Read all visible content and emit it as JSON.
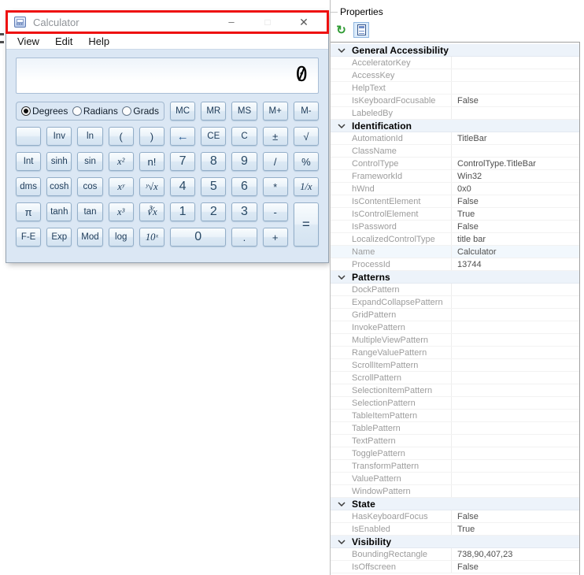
{
  "calc": {
    "title": "Calculator",
    "window_icons": {
      "minimize": "–",
      "maximize": "□",
      "close": "✕"
    },
    "menu": [
      {
        "label": "View",
        "id": "view"
      },
      {
        "label": "Edit",
        "id": "edit"
      },
      {
        "label": "Help",
        "id": "help"
      }
    ],
    "display_value": "0",
    "angle_modes": [
      {
        "label": "Degrees",
        "id": "degrees",
        "selected": true
      },
      {
        "label": "Radians",
        "id": "radians",
        "selected": false
      },
      {
        "label": "Grads",
        "id": "grads",
        "selected": false
      }
    ],
    "memory_keys": [
      {
        "label": "MC",
        "id": "memory-clear"
      },
      {
        "label": "MR",
        "id": "memory-recall"
      },
      {
        "label": "MS",
        "id": "memory-store"
      },
      {
        "label": "M+",
        "id": "memory-add"
      },
      {
        "label": "M-",
        "id": "memory-subtract"
      }
    ],
    "keys": [
      {
        "label": "",
        "id": "blank",
        "cls": "blank"
      },
      {
        "label": "Inv",
        "id": "inverse"
      },
      {
        "label": "ln",
        "id": "natural-log"
      },
      {
        "label": "(",
        "id": "open-paren",
        "cls": "op"
      },
      {
        "label": ")",
        "id": "close-paren",
        "cls": "op"
      },
      {
        "label": "←",
        "id": "backspace",
        "cls": "backspace"
      },
      {
        "label": "CE",
        "id": "clear-entry"
      },
      {
        "label": "C",
        "id": "clear"
      },
      {
        "label": "±",
        "id": "negate",
        "cls": "op"
      },
      {
        "label": "√",
        "id": "sqrt",
        "cls": "op"
      },
      {
        "label": "Int",
        "id": "int"
      },
      {
        "label": "sinh",
        "id": "sinh"
      },
      {
        "label": "sin",
        "id": "sin"
      },
      {
        "label": "x²",
        "id": "x-squared",
        "cls": "it"
      },
      {
        "label": "n!",
        "id": "factorial",
        "cls": "op"
      },
      {
        "label": "7",
        "id": "7",
        "cls": "num"
      },
      {
        "label": "8",
        "id": "8",
        "cls": "num"
      },
      {
        "label": "9",
        "id": "9",
        "cls": "num"
      },
      {
        "label": "/",
        "id": "divide",
        "cls": "op"
      },
      {
        "label": "%",
        "id": "percent",
        "cls": "op"
      },
      {
        "label": "dms",
        "id": "dms"
      },
      {
        "label": "cosh",
        "id": "cosh"
      },
      {
        "label": "cos",
        "id": "cos"
      },
      {
        "label": "xʸ",
        "id": "x-pow-y",
        "cls": "it"
      },
      {
        "label": "ʸ√x",
        "id": "y-root",
        "cls": "it"
      },
      {
        "label": "4",
        "id": "4",
        "cls": "num"
      },
      {
        "label": "5",
        "id": "5",
        "cls": "num"
      },
      {
        "label": "6",
        "id": "6",
        "cls": "num"
      },
      {
        "label": "*",
        "id": "multiply",
        "cls": "op"
      },
      {
        "label": "1/x",
        "id": "reciprocal",
        "cls": "it"
      },
      {
        "label": "π",
        "id": "pi",
        "cls": "op"
      },
      {
        "label": "tanh",
        "id": "tanh"
      },
      {
        "label": "tan",
        "id": "tan"
      },
      {
        "label": "x³",
        "id": "x-cubed",
        "cls": "it"
      },
      {
        "label": "∛x",
        "id": "cube-root",
        "cls": "it"
      },
      {
        "label": "1",
        "id": "1",
        "cls": "num"
      },
      {
        "label": "2",
        "id": "2",
        "cls": "num"
      },
      {
        "label": "3",
        "id": "3",
        "cls": "num"
      },
      {
        "label": "-",
        "id": "subtract",
        "cls": "op"
      },
      {
        "label": "=",
        "id": "equals",
        "cls": "eq"
      },
      {
        "label": "F-E",
        "id": "fe"
      },
      {
        "label": "Exp",
        "id": "exp"
      },
      {
        "label": "Mod",
        "id": "mod"
      },
      {
        "label": "log",
        "id": "log"
      },
      {
        "label": "10ˣ",
        "id": "10-pow-x",
        "cls": "it"
      },
      {
        "label": "0",
        "id": "0",
        "cls": "num zero"
      },
      {
        "label": ".",
        "id": "decimal",
        "cls": "op"
      },
      {
        "label": "+",
        "id": "add",
        "cls": "op"
      }
    ]
  },
  "inspector": {
    "title": "Properties",
    "icons": {
      "refresh_glyph": "↻"
    },
    "rows": [
      {
        "type": "header",
        "name": "General Accessibility"
      },
      {
        "type": "prop",
        "name": "AcceleratorKey",
        "value": ""
      },
      {
        "type": "prop",
        "name": "AccessKey",
        "value": ""
      },
      {
        "type": "prop",
        "name": "HelpText",
        "value": ""
      },
      {
        "type": "prop",
        "name": "IsKeyboardFocusable",
        "value": "False"
      },
      {
        "type": "prop",
        "name": "LabeledBy",
        "value": ""
      },
      {
        "type": "header",
        "name": "Identification"
      },
      {
        "type": "prop",
        "name": "AutomationId",
        "value": "TitleBar"
      },
      {
        "type": "prop",
        "name": "ClassName",
        "value": ""
      },
      {
        "type": "prop",
        "name": "ControlType",
        "value": "ControlType.TitleBar"
      },
      {
        "type": "prop",
        "name": "FrameworkId",
        "value": "Win32"
      },
      {
        "type": "prop",
        "name": "hWnd",
        "value": "0x0"
      },
      {
        "type": "prop",
        "name": "IsContentElement",
        "value": "False"
      },
      {
        "type": "prop",
        "name": "IsControlElement",
        "value": "True"
      },
      {
        "type": "prop",
        "name": "IsPassword",
        "value": "False"
      },
      {
        "type": "prop",
        "name": "LocalizedControlType",
        "value": "title bar"
      },
      {
        "type": "prop",
        "name": "Name",
        "value": "Calculator",
        "highlight": true
      },
      {
        "type": "prop",
        "name": "ProcessId",
        "value": "13744"
      },
      {
        "type": "header",
        "name": "Patterns"
      },
      {
        "type": "prop",
        "name": "DockPattern",
        "value": ""
      },
      {
        "type": "prop",
        "name": "ExpandCollapsePattern",
        "value": ""
      },
      {
        "type": "prop",
        "name": "GridPattern",
        "value": ""
      },
      {
        "type": "prop",
        "name": "InvokePattern",
        "value": ""
      },
      {
        "type": "prop",
        "name": "MultipleViewPattern",
        "value": ""
      },
      {
        "type": "prop",
        "name": "RangeValuePattern",
        "value": ""
      },
      {
        "type": "prop",
        "name": "ScrollItemPattern",
        "value": ""
      },
      {
        "type": "prop",
        "name": "ScrollPattern",
        "value": ""
      },
      {
        "type": "prop",
        "name": "SelectionItemPattern",
        "value": ""
      },
      {
        "type": "prop",
        "name": "SelectionPattern",
        "value": ""
      },
      {
        "type": "prop",
        "name": "TableItemPattern",
        "value": ""
      },
      {
        "type": "prop",
        "name": "TablePattern",
        "value": ""
      },
      {
        "type": "prop",
        "name": "TextPattern",
        "value": ""
      },
      {
        "type": "prop",
        "name": "TogglePattern",
        "value": ""
      },
      {
        "type": "prop",
        "name": "TransformPattern",
        "value": ""
      },
      {
        "type": "prop",
        "name": "ValuePattern",
        "value": ""
      },
      {
        "type": "prop",
        "name": "WindowPattern",
        "value": ""
      },
      {
        "type": "header",
        "name": "State"
      },
      {
        "type": "prop",
        "name": "HasKeyboardFocus",
        "value": "False"
      },
      {
        "type": "prop",
        "name": "IsEnabled",
        "value": "True"
      },
      {
        "type": "header",
        "name": "Visibility"
      },
      {
        "type": "prop",
        "name": "BoundingRectangle",
        "value": "738,90,407,23"
      },
      {
        "type": "prop",
        "name": "IsOffscreen",
        "value": "False"
      }
    ]
  }
}
